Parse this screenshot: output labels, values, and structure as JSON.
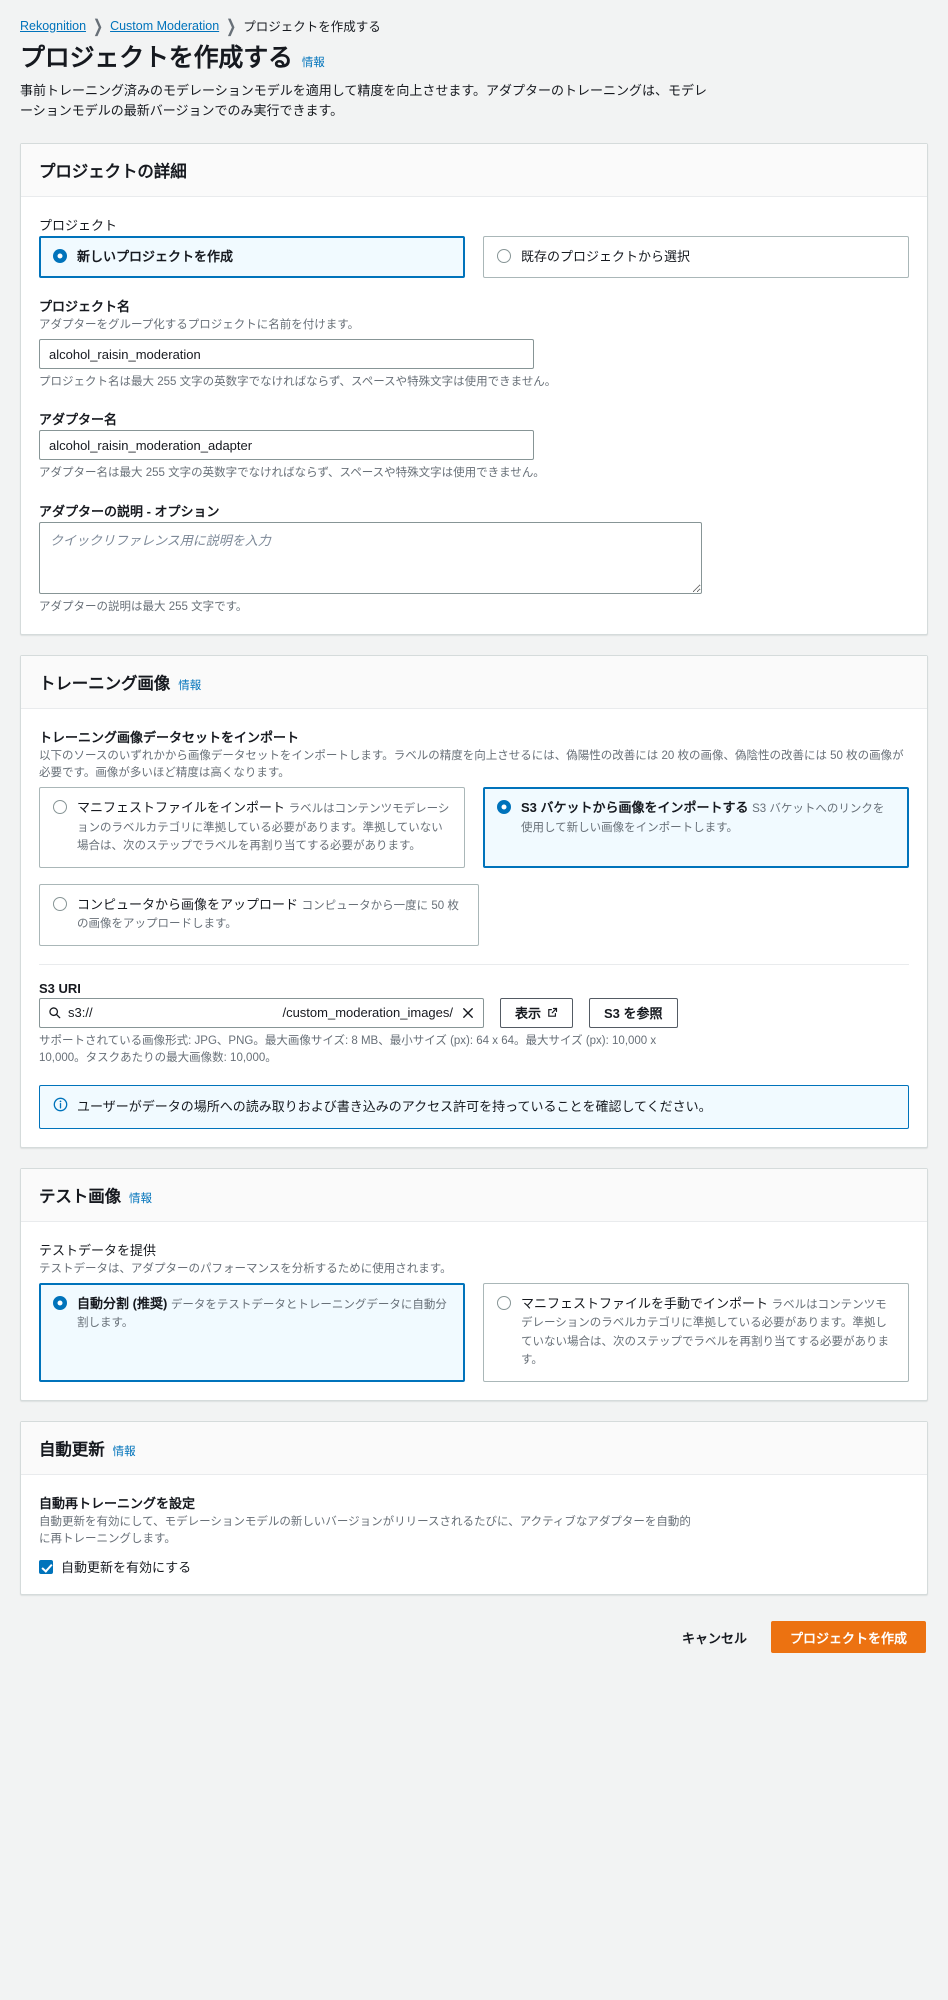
{
  "breadcrumb": {
    "items": [
      {
        "label": "Rekognition",
        "link": true
      },
      {
        "label": "Custom Moderation",
        "link": true
      },
      {
        "label": "プロジェクトを作成する",
        "link": false
      }
    ],
    "separator": "❯"
  },
  "header": {
    "title": "プロジェクトを作成する",
    "info_label": "情報",
    "description": "事前トレーニング済みのモデレーションモデルを適用して精度を向上させます。アダプターのトレーニングは、モデレーションモデルの最新バージョンでのみ実行できます。"
  },
  "project_details": {
    "title": "プロジェクトの詳細",
    "project_label": "プロジェクト",
    "project_options": [
      {
        "label": "新しいプロジェクトを作成",
        "selected": true
      },
      {
        "label": "既存のプロジェクトから選択",
        "selected": false
      }
    ],
    "project_name_label": "プロジェクト名",
    "project_name_hint": "アダプターをグループ化するプロジェクトに名前を付けます。",
    "project_name_value": "alcohol_raisin_moderation",
    "project_name_foot": "プロジェクト名は最大 255 文字の英数字でなければならず、スペースや特殊文字は使用できません。",
    "adapter_name_label": "アダプター名",
    "adapter_name_value": "alcohol_raisin_moderation_adapter",
    "adapter_name_foot": "アダプター名は最大 255 文字の英数字でなければならず、スペースや特殊文字は使用できません。",
    "adapter_desc_label": "アダプターの説明 - オプション",
    "adapter_desc_placeholder": "クイックリファレンス用に説明を入力",
    "adapter_desc_value": "",
    "adapter_desc_foot": "アダプターの説明は最大 255 文字です。"
  },
  "training_images": {
    "title": "トレーニング画像",
    "info_label": "情報",
    "import_label": "トレーニング画像データセットをインポート",
    "import_desc": "以下のソースのいずれかから画像データセットをインポートします。ラベルの精度を向上させるには、偽陽性の改善には 20 枚の画像、偽陰性の改善には 50 枚の画像が必要です。画像が多いほど精度は高くなります。",
    "options": [
      {
        "label": "マニフェストファイルをインポート",
        "desc": "ラベルはコンテンツモデレーションのラベルカテゴリに準拠している必要があります。準拠していない場合は、次のステップでラベルを再割り当てする必要があります。",
        "selected": false
      },
      {
        "label": "S3 バケットから画像をインポートする",
        "desc": "S3 バケットへのリンクを使用して新しい画像をインポートします。",
        "selected": true
      },
      {
        "label": "コンピュータから画像をアップロード",
        "desc": "コンピュータから一度に 50 枚の画像をアップロードします。",
        "selected": false
      }
    ],
    "s3_uri_label": "S3 URI",
    "s3_uri_scheme": "s3://",
    "s3_uri_path": "/custom_moderation_images/",
    "view_button": "表示",
    "browse_button": "S3 を参照",
    "s3_foot": "サポートされている画像形式: JPG、PNG。最大画像サイズ: 8 MB、最小サイズ (px): 64 x 64。最大サイズ (px): 10,000 x 10,000。タスクあたりの最大画像数: 10,000。",
    "alert_text": "ユーザーがデータの場所への読み取りおよび書き込みのアクセス許可を持っていることを確認してください。"
  },
  "test_images": {
    "title": "テスト画像",
    "info_label": "情報",
    "provide_label": "テストデータを提供",
    "provide_desc": "テストデータは、アダプターのパフォーマンスを分析するために使用されます。",
    "options": [
      {
        "label": "自動分割 (推奨)",
        "desc": "データをテストデータとトレーニングデータに自動分割します。",
        "selected": true
      },
      {
        "label": "マニフェストファイルを手動でインポート",
        "desc": "ラベルはコンテンツモデレーションのラベルカテゴリに準拠している必要があります。準拠していない場合は、次のステップでラベルを再割り当てする必要があります。",
        "selected": false
      }
    ]
  },
  "auto_update": {
    "title": "自動更新",
    "info_label": "情報",
    "setting_label": "自動再トレーニングを設定",
    "setting_desc": "自動更新を有効にして、モデレーションモデルの新しいバージョンがリリースされるたびに、アクティブなアダプターを自動的に再トレーニングします。",
    "checkbox_label": "自動更新を有効にする",
    "checkbox_checked": true
  },
  "footer": {
    "cancel_label": "キャンセル",
    "submit_label": "プロジェクトを作成"
  },
  "colors": {
    "accent": "#0073bb",
    "primary_button": "#ec7211",
    "page_background": "#f2f3f3"
  }
}
